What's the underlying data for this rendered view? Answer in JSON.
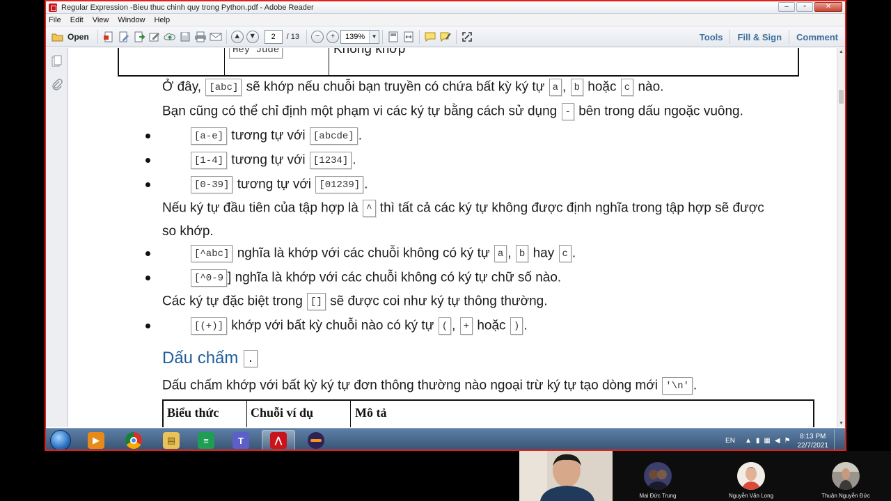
{
  "window": {
    "title": "Regular Expression -Bieu thuc chinh quy trong Python.pdf - Adobe Reader",
    "controls": [
      "–",
      "▫",
      "✕"
    ]
  },
  "menu": [
    "File",
    "Edit",
    "View",
    "Window",
    "Help"
  ],
  "toolbar": {
    "open_label": "Open",
    "page_current": "2",
    "page_total": "/ 13",
    "zoom": "139%",
    "tools_label": "Tools",
    "fill_sign_label": "Fill & Sign",
    "comment_label": "Comment"
  },
  "document": {
    "top_table": {
      "cell_code": "Hey Jude",
      "cell_desc": "Không khớp"
    },
    "para1": {
      "a": "Ở đây, ",
      "code1": "[abc]",
      "b": " sẽ khớp nếu chuỗi bạn truyền có chứa bất kỳ ký tự ",
      "code2": "a",
      "sep1": ", ",
      "code3": "b",
      "c": " hoặc ",
      "code4": "c",
      "d": " nào."
    },
    "para2": {
      "a": "Bạn cũng có thể chỉ định một phạm vi các ký tự bằng cách sử dụng ",
      "code1": "-",
      "b": " bên trong dấu ngoặc vuông."
    },
    "bullets1": [
      {
        "code1": "[a-e]",
        "text": " tương tự với ",
        "code2": "[abcde]",
        "end": "."
      },
      {
        "code1": "[1-4]",
        "text": " tương tự với ",
        "code2": "[1234]",
        "end": "."
      },
      {
        "code1": "[0-39]",
        "text": " tương tự với ",
        "code2": "[01239]",
        "end": "."
      }
    ],
    "para3": {
      "a": "Nếu ký tự đầu tiên của tập hợp là ",
      "code1": "^",
      "b": " thì tất cả các ký tự không được định nghĩa trong tập hợp sẽ được",
      "line2": "so khớp."
    },
    "bullets2": [
      {
        "code1": "[^abc]",
        "a": " nghĩa là khớp với các chuỗi không có ký tự ",
        "code2": "a",
        "sep": ", ",
        "code3": "b",
        "b": " hay ",
        "code4": "c",
        "end": "."
      },
      {
        "code1": "[^0-9",
        "a": "] nghĩa là khớp với các chuỗi không có ký tự chữ số nào."
      }
    ],
    "para4": {
      "a": "Các ký tự đặc biệt trong ",
      "code1": "[]",
      "b": " sẽ được coi như ký tự thông thường."
    },
    "bullets3": [
      {
        "code1": "[(+)]",
        "a": " khớp với bất kỳ chuỗi nào có ký tự ",
        "code2": "(",
        "sep": ", ",
        "code3": "+",
        "b": " hoặc ",
        "code4": ")",
        "end": "."
      }
    ],
    "heading": {
      "text": "Dấu chấm ",
      "code": "."
    },
    "para5": {
      "a": "Dấu chấm khớp với bất kỳ ký tự đơn thông thường nào ngoại trừ ký tự tạo dòng mới ",
      "code1": "'\\n'",
      "end": "."
    },
    "bottom_table": {
      "headers": [
        "Biểu thức",
        "Chuỗi ví dụ",
        "Mô tả"
      ]
    }
  },
  "taskbar": {
    "lang": "EN",
    "time": "8:13 PM",
    "date": "22/7/2021",
    "apps": [
      "media-player-icon",
      "chrome-icon",
      "file-explorer-icon",
      "spreadsheet-icon",
      "teams-icon",
      "adobe-reader-icon",
      "eclipse-icon"
    ]
  },
  "call": {
    "participants": [
      "Mai Đức Trung",
      "Nguyễn Văn Long",
      "Thuận Nguyễn Đức"
    ]
  }
}
